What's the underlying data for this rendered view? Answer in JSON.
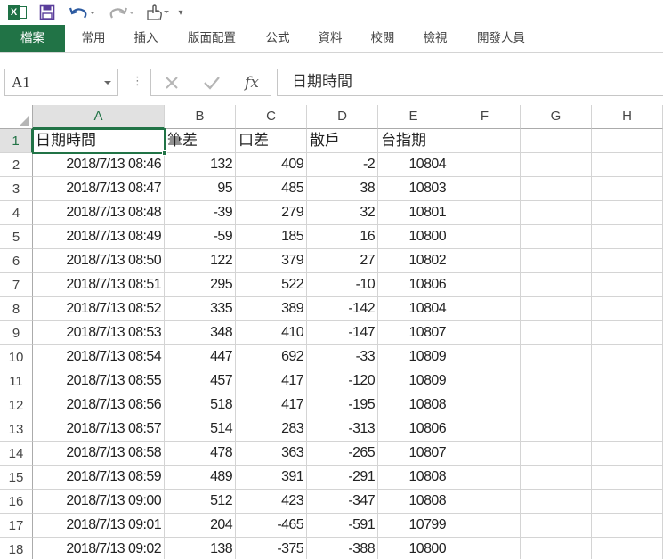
{
  "quick_access": {
    "app_icon": "excel-logo-icon",
    "app_letter": "X",
    "save_icon": "save-icon",
    "undo_icon": "undo-icon",
    "redo_icon": "redo-icon",
    "touch_icon": "touch-mode-icon",
    "customize_label": "▾"
  },
  "ribbon": {
    "tabs": [
      "檔案",
      "常用",
      "插入",
      "版面配置",
      "公式",
      "資料",
      "校閱",
      "檢視",
      "開發人員"
    ]
  },
  "formula_bar": {
    "name_box": "A1",
    "cancel_icon": "cancel-icon",
    "enter_icon": "enter-check-icon",
    "fx_label": "fx",
    "formula": "日期時間"
  },
  "sheet": {
    "active_cell": "A1",
    "columns": [
      "A",
      "B",
      "C",
      "D",
      "E",
      "F",
      "G",
      "H"
    ],
    "row_numbers": [
      "1",
      "2",
      "3",
      "4",
      "5",
      "6",
      "7",
      "8",
      "9",
      "10",
      "11",
      "12",
      "13",
      "14",
      "15",
      "16",
      "17",
      "18"
    ],
    "header_row": [
      "日期時間",
      "筆差",
      "口差",
      "散戶",
      "台指期"
    ],
    "rows": [
      [
        "2018/7/13 08:46",
        "132",
        "409",
        "-2",
        "10804"
      ],
      [
        "2018/7/13 08:47",
        "95",
        "485",
        "38",
        "10803"
      ],
      [
        "2018/7/13 08:48",
        "-39",
        "279",
        "32",
        "10801"
      ],
      [
        "2018/7/13 08:49",
        "-59",
        "185",
        "16",
        "10800"
      ],
      [
        "2018/7/13 08:50",
        "122",
        "379",
        "27",
        "10802"
      ],
      [
        "2018/7/13 08:51",
        "295",
        "522",
        "-10",
        "10806"
      ],
      [
        "2018/7/13 08:52",
        "335",
        "389",
        "-142",
        "10804"
      ],
      [
        "2018/7/13 08:53",
        "348",
        "410",
        "-147",
        "10807"
      ],
      [
        "2018/7/13 08:54",
        "447",
        "692",
        "-33",
        "10809"
      ],
      [
        "2018/7/13 08:55",
        "457",
        "417",
        "-120",
        "10809"
      ],
      [
        "2018/7/13 08:56",
        "518",
        "417",
        "-195",
        "10808"
      ],
      [
        "2018/7/13 08:57",
        "514",
        "283",
        "-313",
        "10806"
      ],
      [
        "2018/7/13 08:58",
        "478",
        "363",
        "-265",
        "10807"
      ],
      [
        "2018/7/13 08:59",
        "489",
        "391",
        "-291",
        "10808"
      ],
      [
        "2018/7/13 09:00",
        "512",
        "423",
        "-347",
        "10808"
      ],
      [
        "2018/7/13 09:01",
        "204",
        "-465",
        "-591",
        "10799"
      ],
      [
        "2018/7/13 09:02",
        "138",
        "-375",
        "-388",
        "10800"
      ]
    ]
  },
  "colors": {
    "accent": "#217346",
    "gridline": "#d4d4d4",
    "header_selected_bg": "#e1e1e1"
  }
}
